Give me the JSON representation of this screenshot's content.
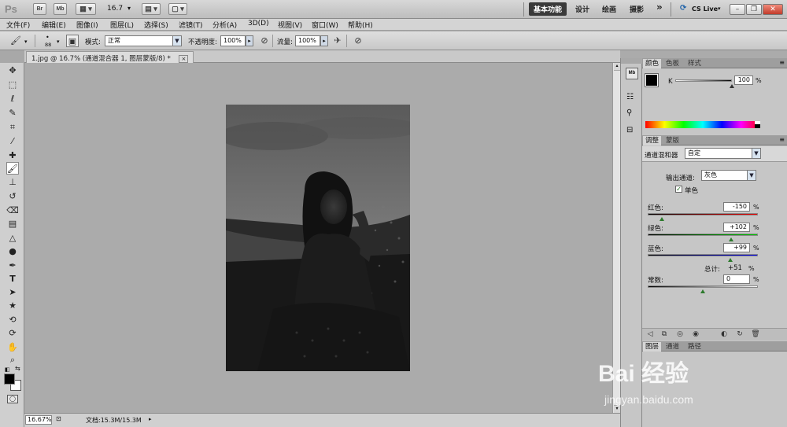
{
  "app": {
    "logo": "Ps",
    "bridge": "Br",
    "minibridge": "Mb",
    "zoom": "16.7",
    "workspaces": [
      "基本功能",
      "设计",
      "绘画",
      "摄影"
    ],
    "more": "»",
    "cslive": "CS Live"
  },
  "menu": [
    "文件(F)",
    "编辑(E)",
    "图像(I)",
    "图层(L)",
    "选择(S)",
    "滤镜(T)",
    "分析(A)",
    "3D(D)",
    "视图(V)",
    "窗口(W)",
    "帮助(H)"
  ],
  "options": {
    "brush_size": "88",
    "mode_label": "模式:",
    "mode_value": "正常",
    "opacity_label": "不透明度:",
    "opacity_value": "100%",
    "flow_label": "流量:",
    "flow_value": "100%"
  },
  "document": {
    "tab_title": "1.jpg @ 16.7% (通道混合器 1, 图层蒙版/8) *",
    "close": "×",
    "zoom_status": "16.67%",
    "doc_size": "文档:15.3M/15.3M"
  },
  "color_panel": {
    "tabs": [
      "颜色",
      "色板",
      "样式"
    ],
    "channel": "K",
    "value": "100",
    "unit": "%"
  },
  "adjust_panel": {
    "tabs": [
      "调整",
      "蒙版"
    ],
    "title": "通道混和器",
    "preset": "自定",
    "output_label": "输出通道:",
    "output_value": "灰色",
    "mono_label": "单色",
    "mono_checked": true,
    "red_label": "红色:",
    "red_value": "-150",
    "red_level": -150,
    "green_label": "绿色:",
    "green_value": "+102",
    "green_level": 102,
    "blue_label": "蓝色:",
    "blue_value": "+99",
    "blue_level": 99,
    "total_label": "总计:",
    "total_value": "+51",
    "const_label": "常数:",
    "const_value": "0",
    "const_level": 0,
    "unit": "%"
  },
  "layers_panel": {
    "tabs": [
      "图层",
      "通道",
      "路径"
    ]
  },
  "colors": {
    "workspace_active": "#3a3a3a",
    "foreground": "#000000",
    "background": "#ffffff",
    "slider_thumb": "#2c7a2c"
  },
  "watermark": {
    "brand": "Bai 经验",
    "url": "jingyan.baidu.com"
  }
}
